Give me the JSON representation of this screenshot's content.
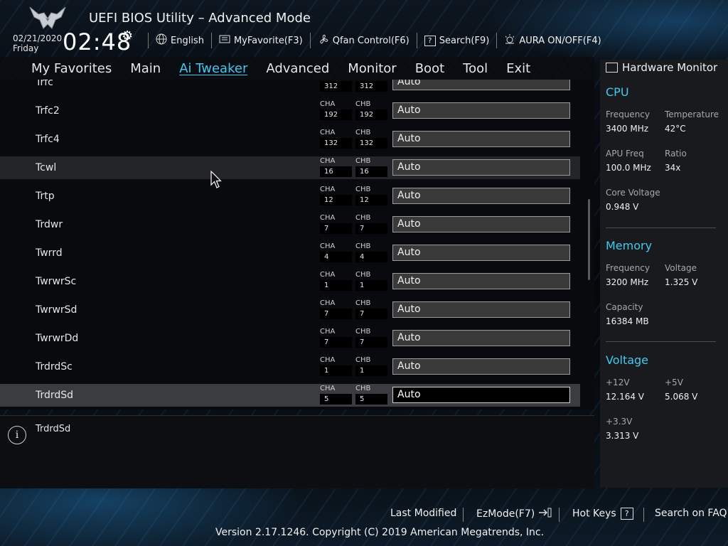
{
  "header": {
    "title": "UEFI BIOS Utility – Advanced Mode",
    "date": "02/21/2020",
    "day": "Friday",
    "time": "02:48"
  },
  "toolbar": {
    "language": "English",
    "favorite": "MyFavorite(F3)",
    "qfan": "Qfan Control(F6)",
    "search": "Search(F9)",
    "aura": "AURA ON/OFF(F4)"
  },
  "nav": {
    "tabs": [
      {
        "label": "My Favorites"
      },
      {
        "label": "Main"
      },
      {
        "label": "Ai Tweaker"
      },
      {
        "label": "Advanced"
      },
      {
        "label": "Monitor"
      },
      {
        "label": "Boot"
      },
      {
        "label": "Tool"
      },
      {
        "label": "Exit"
      }
    ],
    "active_tab": "Ai Tweaker"
  },
  "channel_labels": {
    "a": "CHA",
    "b": "CHB"
  },
  "rows": [
    {
      "label": "Trfc",
      "cha": "312",
      "chb": "312",
      "value": "Auto"
    },
    {
      "label": "Trfc2",
      "cha": "192",
      "chb": "192",
      "value": "Auto"
    },
    {
      "label": "Trfc4",
      "cha": "132",
      "chb": "132",
      "value": "Auto"
    },
    {
      "label": "Tcwl",
      "cha": "16",
      "chb": "16",
      "value": "Auto"
    },
    {
      "label": "Trtp",
      "cha": "12",
      "chb": "12",
      "value": "Auto"
    },
    {
      "label": "Trdwr",
      "cha": "7",
      "chb": "7",
      "value": "Auto"
    },
    {
      "label": "Twrrd",
      "cha": "4",
      "chb": "4",
      "value": "Auto"
    },
    {
      "label": "TwrwrSc",
      "cha": "1",
      "chb": "1",
      "value": "Auto"
    },
    {
      "label": "TwrwrSd",
      "cha": "7",
      "chb": "7",
      "value": "Auto"
    },
    {
      "label": "TwrwrDd",
      "cha": "7",
      "chb": "7",
      "value": "Auto"
    },
    {
      "label": "TrdrdSc",
      "cha": "1",
      "chb": "1",
      "value": "Auto"
    },
    {
      "label": "TrdrdSd",
      "cha": "5",
      "chb": "5",
      "value": "Auto"
    }
  ],
  "help": {
    "text": "TrdrdSd"
  },
  "hardware_monitor": {
    "title": "Hardware Monitor",
    "cpu": {
      "title": "CPU",
      "frequency_label": "Frequency",
      "frequency": "3400 MHz",
      "temperature_label": "Temperature",
      "temperature": "42°C",
      "apu_label": "APU Freq",
      "apu": "100.0 MHz",
      "ratio_label": "Ratio",
      "ratio": "34x",
      "core_voltage_label": "Core Voltage",
      "core_voltage": "0.948 V"
    },
    "memory": {
      "title": "Memory",
      "frequency_label": "Frequency",
      "frequency": "3200 MHz",
      "voltage_label": "Voltage",
      "voltage": "1.325 V",
      "capacity_label": "Capacity",
      "capacity": "16384 MB"
    },
    "voltage": {
      "title": "Voltage",
      "v12_label": "+12V",
      "v12": "12.164 V",
      "v5_label": "+5V",
      "v5": "5.068 V",
      "v33_label": "+3.3V",
      "v33": "3.313 V"
    }
  },
  "footer": {
    "last_modified": "Last Modified",
    "ezmode": "EzMode(F7)",
    "hotkeys": "Hot Keys",
    "faq": "Search on FAQ",
    "copyright": "Version 2.17.1246. Copyright (C) 2019 American Megatrends, Inc."
  },
  "colors": {
    "accent": "#45c8f0",
    "selected_row": "#3a3c40",
    "hover_row": "#232529"
  }
}
